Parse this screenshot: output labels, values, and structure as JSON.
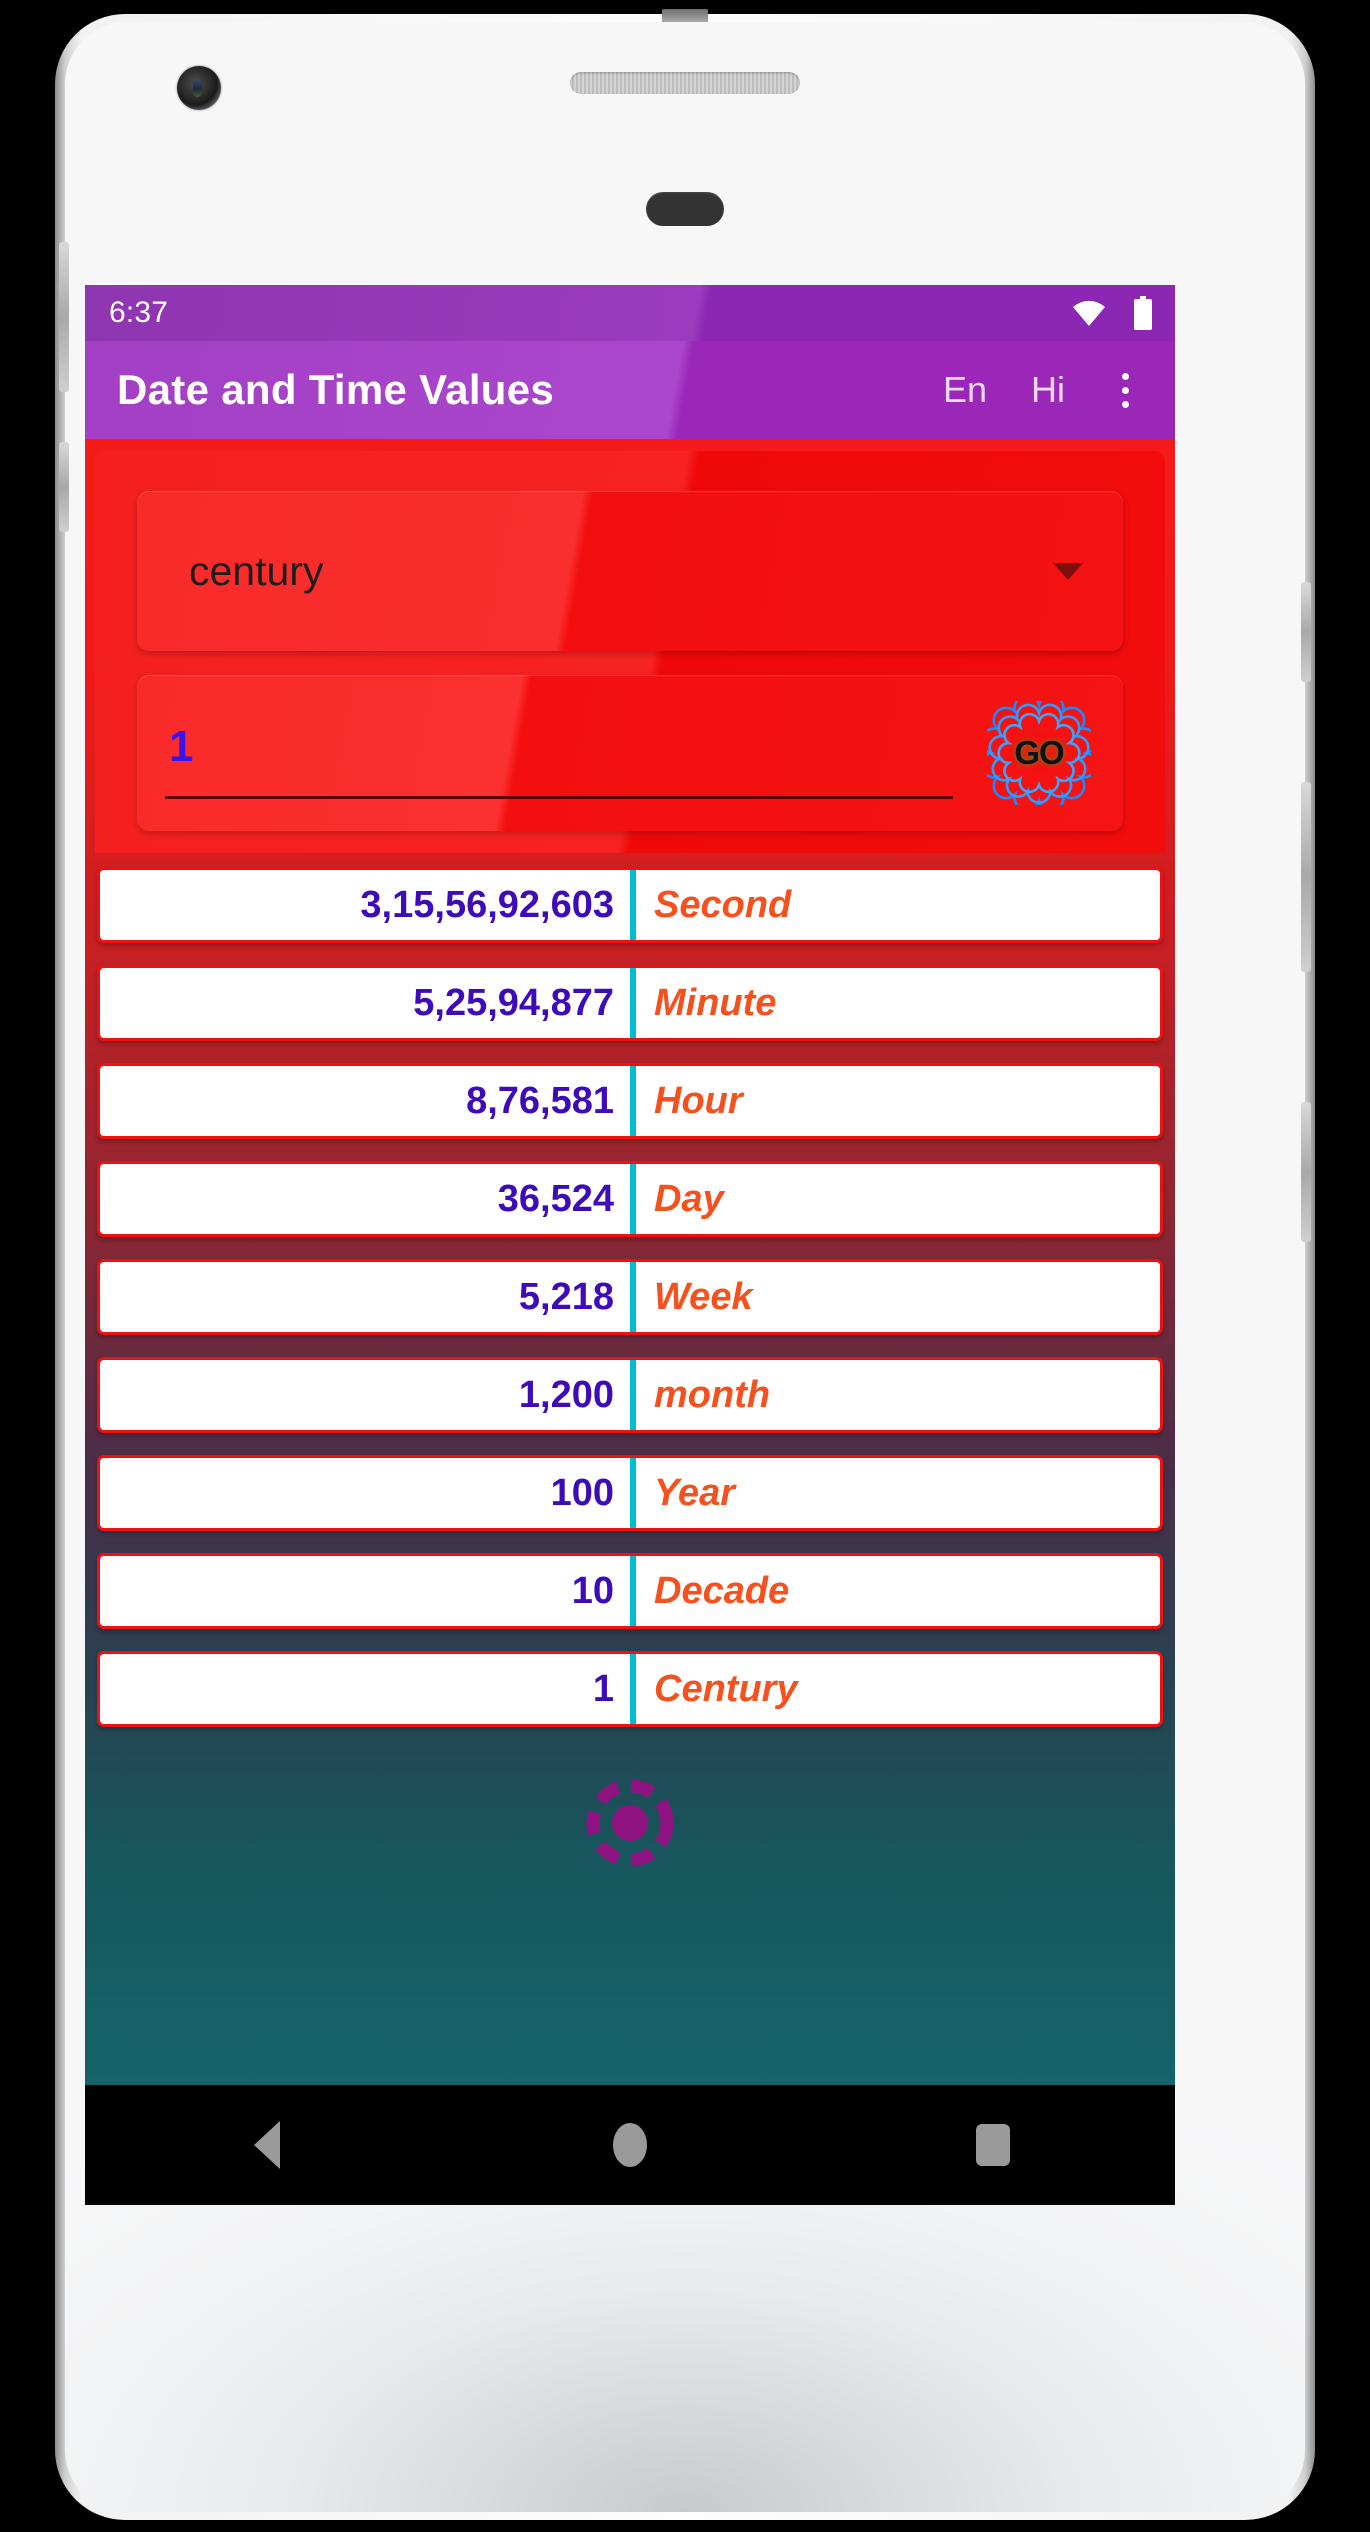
{
  "status_bar": {
    "time": "6:37",
    "wifi_icon": "wifi-icon",
    "battery_icon": "battery-icon"
  },
  "app_bar": {
    "title": "Date and Time Values",
    "lang_en": "En",
    "lang_hi": "Hi",
    "overflow_icon": "overflow-menu-icon"
  },
  "converter": {
    "unit_spinner_value": "century",
    "unit_spinner_caret": "chevron-down-icon",
    "amount_value": "1",
    "amount_placeholder": "",
    "go_label": "GO"
  },
  "results": {
    "rows": [
      {
        "value": "3,15,56,92,603",
        "unit": "Second"
      },
      {
        "value": "5,25,94,877",
        "unit": "Minute"
      },
      {
        "value": "8,76,581",
        "unit": "Hour"
      },
      {
        "value": "36,524",
        "unit": "Day"
      },
      {
        "value": "5,218",
        "unit": "Week"
      },
      {
        "value": "1,200",
        "unit": "month"
      },
      {
        "value": "100",
        "unit": "Year"
      },
      {
        "value": "10",
        "unit": "Decade"
      },
      {
        "value": "1",
        "unit": "Century"
      }
    ]
  },
  "indicator": {
    "icon": "dotted-circle-indicator"
  },
  "nav_bar": {
    "back": "back-icon",
    "home": "home-icon",
    "recents": "recents-icon"
  },
  "colors": {
    "app_bar": "#9b27b8",
    "status_bar": "#8b27b2",
    "panel_red": "#f51b1b",
    "value_purple": "#3d0bb9",
    "unit_orange": "#f4511e",
    "divider_cyan": "#00bcd4",
    "gradient_bottom_teal": "#15646b",
    "indicator_purple": "#8e1380"
  }
}
